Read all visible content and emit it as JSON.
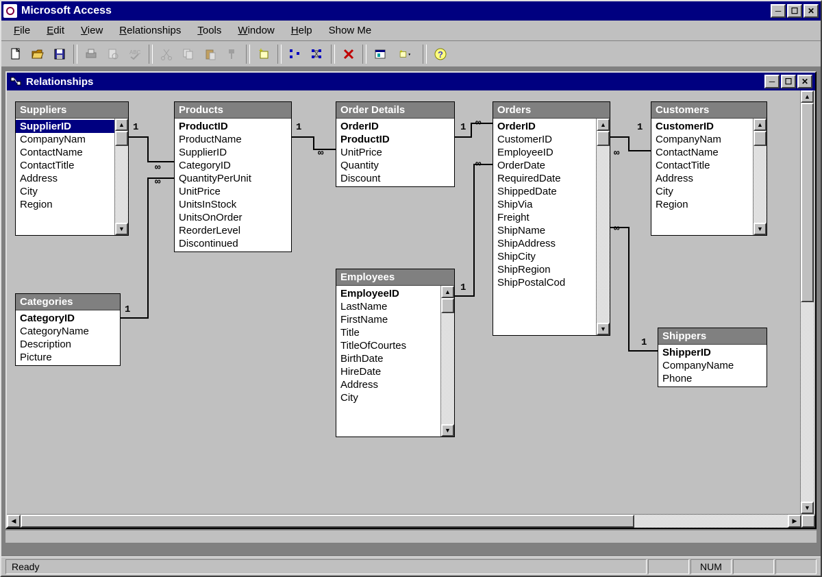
{
  "app": {
    "title": "Microsoft Access"
  },
  "menubar": [
    {
      "label": "File",
      "u": 0
    },
    {
      "label": "Edit",
      "u": 0
    },
    {
      "label": "View",
      "u": 0
    },
    {
      "label": "Relationships",
      "u": 0
    },
    {
      "label": "Tools",
      "u": 0
    },
    {
      "label": "Window",
      "u": 0
    },
    {
      "label": "Help",
      "u": 0
    },
    {
      "label": "Show Me",
      "u": null
    }
  ],
  "inner_window": {
    "title": "Relationships"
  },
  "statusbar": {
    "main": "Ready",
    "num": "NUM"
  },
  "tables": {
    "suppliers": {
      "title": "Suppliers",
      "fields": [
        "SupplierID",
        "CompanyNam",
        "ContactName",
        "ContactTitle",
        "Address",
        "City",
        "Region"
      ],
      "pk": [
        0
      ],
      "selected": 0,
      "scrollable": true
    },
    "products": {
      "title": "Products",
      "fields": [
        "ProductID",
        "ProductName",
        "SupplierID",
        "CategoryID",
        "QuantityPerUnit",
        "UnitPrice",
        "UnitsInStock",
        "UnitsOnOrder",
        "ReorderLevel",
        "Discontinued"
      ],
      "pk": [
        0
      ]
    },
    "order_details": {
      "title": "Order Details",
      "fields": [
        "OrderID",
        "ProductID",
        "UnitPrice",
        "Quantity",
        "Discount"
      ],
      "pk": [
        0,
        1
      ]
    },
    "orders": {
      "title": "Orders",
      "fields": [
        "OrderID",
        "CustomerID",
        "EmployeeID",
        "OrderDate",
        "RequiredDate",
        "ShippedDate",
        "ShipVia",
        "Freight",
        "ShipName",
        "ShipAddress",
        "ShipCity",
        "ShipRegion",
        "ShipPostalCod"
      ],
      "pk": [
        0
      ],
      "scrollable": true
    },
    "customers": {
      "title": "Customers",
      "fields": [
        "CustomerID",
        "CompanyNam",
        "ContactName",
        "ContactTitle",
        "Address",
        "City",
        "Region"
      ],
      "pk": [
        0
      ],
      "scrollable": true
    },
    "employees": {
      "title": "Employees",
      "fields": [
        "EmployeeID",
        "LastName",
        "FirstName",
        "Title",
        "TitleOfCourtes",
        "BirthDate",
        "HireDate",
        "Address",
        "City"
      ],
      "pk": [
        0
      ],
      "scrollable": true
    },
    "categories": {
      "title": "Categories",
      "fields": [
        "CategoryID",
        "CategoryName",
        "Description",
        "Picture"
      ],
      "pk": [
        0
      ]
    },
    "shippers": {
      "title": "Shippers",
      "fields": [
        "ShipperID",
        "CompanyName",
        "Phone"
      ],
      "pk": [
        0
      ]
    }
  },
  "relationships": [
    {
      "from": "suppliers",
      "to": "products",
      "fromLabel": "1",
      "toLabel": "∞"
    },
    {
      "from": "products",
      "to": "order_details",
      "fromLabel": "1",
      "toLabel": "∞"
    },
    {
      "from": "categories",
      "to": "products",
      "fromLabel": "1",
      "toLabel": "∞"
    },
    {
      "from": "orders",
      "to": "order_details",
      "fromLabel": "1",
      "toLabel": "∞"
    },
    {
      "from": "customers",
      "to": "orders",
      "fromLabel": "1",
      "toLabel": "∞"
    },
    {
      "from": "employees",
      "to": "orders",
      "fromLabel": "1",
      "toLabel": "∞"
    },
    {
      "from": "shippers",
      "to": "orders",
      "fromLabel": "1",
      "toLabel": "∞"
    }
  ]
}
